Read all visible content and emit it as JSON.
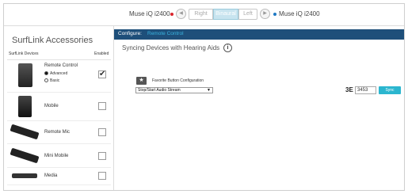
{
  "topbar": {
    "left_device": "Muse iQ i2400",
    "right_device": "Muse iQ i2400",
    "left_dot_color": "#d9262e",
    "right_dot_color": "#1f79c4",
    "segments": [
      "Right",
      "Binaural",
      "Left"
    ],
    "active_segment": "Binaural",
    "left_speaker_icon": "speaker-icon",
    "right_speaker_icon": "speaker-icon"
  },
  "sidebar": {
    "title": "SurfLink Accessories",
    "header_devices": "SurfLink Devices",
    "header_enabled": "Enabled",
    "devices": [
      {
        "label": "Remote Control",
        "checked": "✔",
        "options": [
          "Advanced",
          "Basic"
        ],
        "selected_option": "Advanced"
      },
      {
        "label": "Mobile",
        "checked": ""
      },
      {
        "label": "Remote Mic",
        "checked": ""
      },
      {
        "label": "Mini Mobile",
        "checked": ""
      },
      {
        "label": "Media",
        "checked": ""
      }
    ]
  },
  "main": {
    "configure_label": "Configure:",
    "configure_target": "Remote Control",
    "configure_bar_color": "#1e4f7a",
    "configure_target_color": "#39b4e0",
    "sync_title": "Syncing Devices with Hearing Aids",
    "info_icon_text": "i",
    "favorite_label": "Favorite Button Configuration",
    "favorite_icon": "star-icon",
    "favorite_select_value": "Stop/Start Audio Stream",
    "code_prefix": "3E",
    "code_value": "3453",
    "sync_button": "Sync",
    "sync_button_color": "#2bb6cf"
  }
}
